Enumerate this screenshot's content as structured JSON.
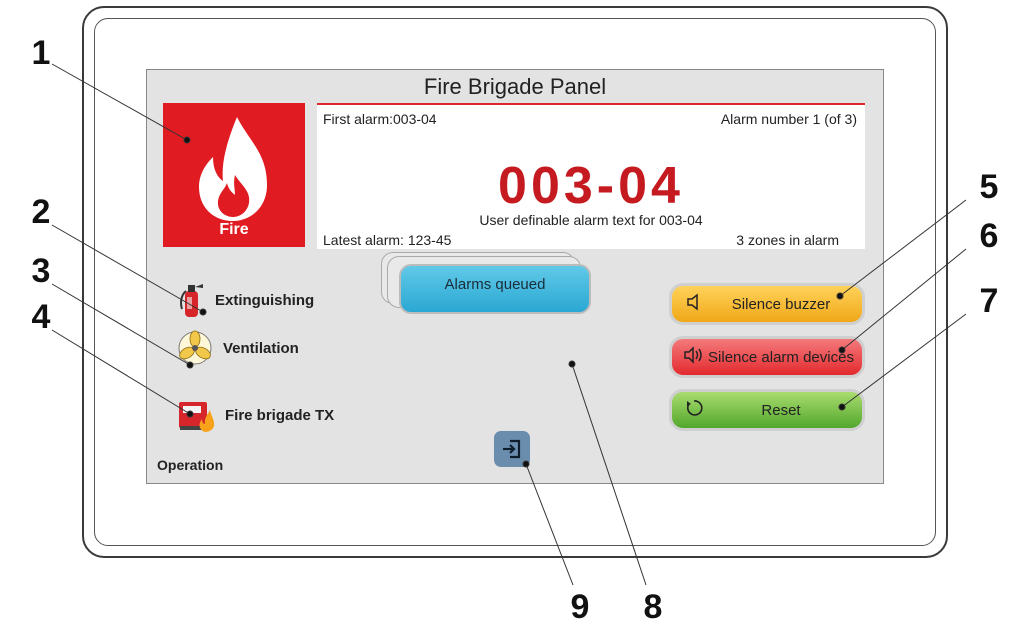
{
  "panel": {
    "title": "Fire Brigade Panel",
    "fire_label": "Fire",
    "first_alarm": "First alarm:003-04",
    "alarm_number": "Alarm number 1 (of 3)",
    "current_alarm_code": "003-04",
    "alarm_text": "User definable alarm text for 003-04",
    "latest_alarm": "Latest alarm: 123-45",
    "zones_in_alarm": "3 zones in alarm"
  },
  "operation": {
    "items": [
      {
        "label": "Extinguishing",
        "icon": "extinguisher-icon"
      },
      {
        "label": "Ventilation",
        "icon": "fan-icon"
      },
      {
        "label": "Fire brigade TX",
        "icon": "fire-truck-icon"
      }
    ],
    "footer": "Operation"
  },
  "buttons": {
    "alarms_queued": "Alarms queued",
    "silence_buzzer": "Silence buzzer",
    "silence_alarm_devices": "Silence alarm devices",
    "reset": "Reset"
  },
  "callouts": [
    "1",
    "2",
    "3",
    "4",
    "5",
    "6",
    "7",
    "8",
    "9"
  ],
  "colors": {
    "fire_red": "#e11b22",
    "alarm_code": "#c41a20",
    "queue_blue": "#2aa8d3",
    "buzzer_yellow": "#f0a818",
    "silence_red": "#e32a2e",
    "reset_green": "#52a72d",
    "logout_blue": "#6b8dad"
  }
}
